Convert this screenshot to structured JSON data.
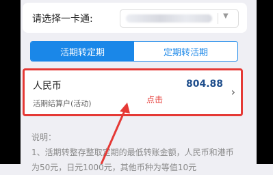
{
  "select_card": {
    "label": "请选择一卡通:",
    "value": ""
  },
  "tabs": [
    {
      "label": "活期转定期",
      "active": true
    },
    {
      "label": "定期转活期",
      "active": false
    }
  ],
  "account": {
    "currency": "人民币",
    "amount": "804.88",
    "type": "活期结算户(活动)"
  },
  "annotation": "点击",
  "notes": {
    "title": "说明：",
    "line1": "1、活期转整存整取定期的最低转账金额，人民币和港币",
    "line2": "为50元，日元1000元，其他币种为等值10元"
  },
  "colors": {
    "accent": "#1a87e8",
    "highlight": "#e53935",
    "amount": "#1f4e8c"
  }
}
